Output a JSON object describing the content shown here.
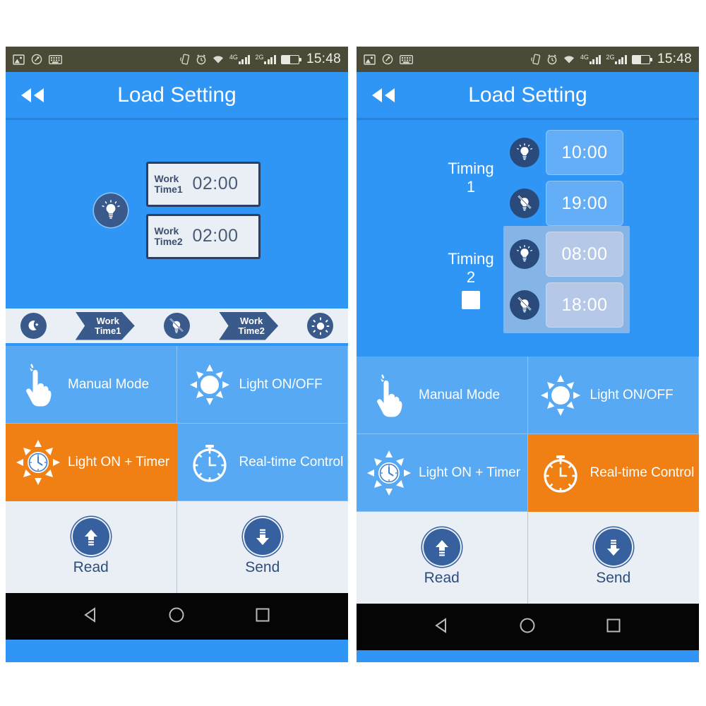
{
  "statusbar": {
    "time": "15:48",
    "left_icons": [
      "image-icon",
      "screenshot-icon",
      "keyboard-icon"
    ],
    "right_icons": [
      "vibrate-icon",
      "alarm-icon",
      "wifi-icon",
      "signal-4g-icon",
      "signal-2g-icon",
      "battery-icon"
    ],
    "net1_label": "4G",
    "net2_label": "2G"
  },
  "header": {
    "title": "Load Setting",
    "back_icon": "rewind-back-icon"
  },
  "left_panel": {
    "bulb_icon": "bulb-on-icon",
    "work_times": [
      {
        "label_line1": "Work",
        "label_line2": "Time1",
        "value": "02:00"
      },
      {
        "label_line1": "Work",
        "label_line2": "Time2",
        "value": "02:00"
      }
    ],
    "legend": [
      {
        "type": "icon",
        "name": "moon-icon"
      },
      {
        "type": "chevron",
        "line1": "Work",
        "line2": "Time1"
      },
      {
        "type": "icon",
        "name": "bulb-off-icon"
      },
      {
        "type": "chevron",
        "line1": "Work",
        "line2": "Time2"
      },
      {
        "type": "icon",
        "name": "sun-icon"
      }
    ],
    "modes": [
      {
        "label": "Manual Mode",
        "icon": "hand-tap-icon",
        "active": false
      },
      {
        "label": "Light ON/OFF",
        "icon": "sun-arrows-icon",
        "active": false
      },
      {
        "label": "Light ON + Timer",
        "icon": "sun-clock-icon",
        "active": true
      },
      {
        "label": "Real-time Control",
        "icon": "stopwatch-icon",
        "active": false
      }
    ],
    "actions": [
      {
        "label": "Read",
        "icon": "upload-arrow-icon"
      },
      {
        "label": "Send",
        "icon": "download-arrow-icon"
      }
    ]
  },
  "right_panel": {
    "timings": [
      {
        "label_line1": "Timing",
        "label_line2": "1",
        "enabled": true,
        "has_checkbox": false,
        "checkbox_checked": false,
        "on": {
          "icon": "bulb-on-icon",
          "value": "10:00"
        },
        "off": {
          "icon": "bulb-off-icon",
          "value": "19:00"
        }
      },
      {
        "label_line1": "Timing",
        "label_line2": "2",
        "enabled": false,
        "has_checkbox": true,
        "checkbox_checked": false,
        "on": {
          "icon": "bulb-on-icon",
          "value": "08:00"
        },
        "off": {
          "icon": "bulb-off-icon",
          "value": "18:00"
        }
      }
    ],
    "modes": [
      {
        "label": "Manual Mode",
        "icon": "hand-tap-icon",
        "active": false
      },
      {
        "label": "Light ON/OFF",
        "icon": "sun-arrows-icon",
        "active": false
      },
      {
        "label": "Light ON + Timer",
        "icon": "sun-clock-icon",
        "active": false
      },
      {
        "label": "Real-time Control",
        "icon": "stopwatch-icon",
        "active": true
      }
    ],
    "actions": [
      {
        "label": "Read",
        "icon": "upload-arrow-icon"
      },
      {
        "label": "Send",
        "icon": "download-arrow-icon"
      }
    ]
  },
  "navbar": {
    "back": "triangle-back-icon",
    "home": "circle-home-icon",
    "recents": "square-recents-icon"
  },
  "colors": {
    "accent_blue": "#2f96f5",
    "mode_blue": "#56a9f2",
    "active_orange": "#f08014",
    "navy": "#3a5a8c",
    "panel_light": "#e9eff5",
    "statusbar": "#4a4a36"
  }
}
